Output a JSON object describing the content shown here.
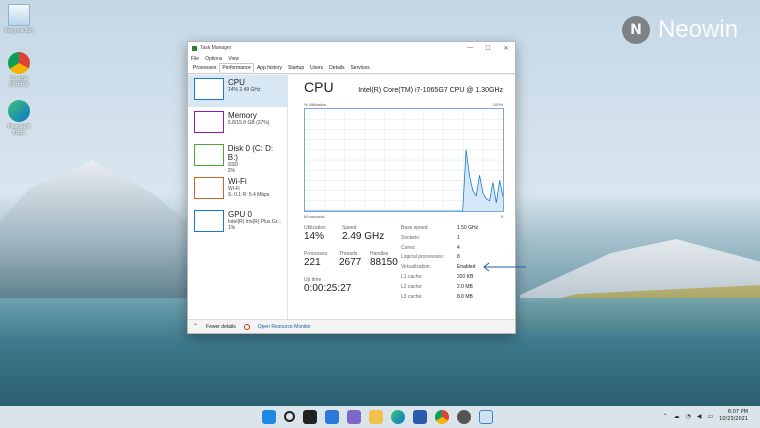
{
  "desktop": {
    "icons": [
      {
        "label": "Recycle Bin",
        "icon": "recycle-bin-icon"
      },
      {
        "label": "Google Chrome",
        "icon": "chrome-icon"
      },
      {
        "label": "Microsoft Edge",
        "icon": "edge-icon"
      }
    ],
    "watermark": "Neowin"
  },
  "window": {
    "title": "Task Manager",
    "menu": [
      "File",
      "Options",
      "View"
    ],
    "tabs": [
      "Processes",
      "Performance",
      "App history",
      "Startup",
      "Users",
      "Details",
      "Services"
    ],
    "active_tab": "Performance"
  },
  "sidebar": {
    "items": [
      {
        "name": "CPU",
        "line1": "14% 2.49 GHz",
        "line2": "",
        "color": "#1a7ac9"
      },
      {
        "name": "Memory",
        "line1": "5.8/15.8 GB (37%)",
        "line2": "",
        "color": "#8c1cc2"
      },
      {
        "name": "Disk 0 (C: D: B:)",
        "line1": "SSD",
        "line2": "2%",
        "color": "#4da835"
      },
      {
        "name": "Wi-Fi",
        "line1": "Wi-Fi",
        "line2": "S: 0.1 R: 5.4 Mbps",
        "color": "#c8672a"
      },
      {
        "name": "GPU 0",
        "line1": "Intel(R) Iris(R) Plus Gr...",
        "line2": "1%",
        "color": "#1a7ac9"
      }
    ]
  },
  "detail": {
    "heading": "CPU",
    "model": "Intel(R) Core(TM) i7-1065G7 CPU @ 1.30GHz",
    "graph_label_left": "% Utilization",
    "graph_label_right": "100%",
    "graph_bottom_left": "60 seconds",
    "graph_bottom_right": "0",
    "utilization_key": "Utilization",
    "utilization_val": "14%",
    "speed_key": "Speed",
    "speed_val": "2.49 GHz",
    "processes_key": "Processes",
    "processes_val": "221",
    "threads_key": "Threads",
    "threads_val": "2677",
    "handles_key": "Handles",
    "handles_val": "88150",
    "uptime_key": "Up time",
    "uptime_val": "0:00:25:27",
    "specs": [
      {
        "k": "Base speed:",
        "v": "1.50 GHz"
      },
      {
        "k": "Sockets:",
        "v": "1"
      },
      {
        "k": "Cores:",
        "v": "4"
      },
      {
        "k": "Logical processors:",
        "v": "8"
      },
      {
        "k": "Virtualization:",
        "v": "Enabled"
      },
      {
        "k": "L1 cache:",
        "v": "320 KB"
      },
      {
        "k": "L2 cache:",
        "v": "2.0 MB"
      },
      {
        "k": "L3 cache:",
        "v": "8.0 MB"
      }
    ]
  },
  "footer": {
    "fewer_details": "Fewer details",
    "open_monitor": "Open Resource Monitor"
  },
  "taskbar": {
    "apps": [
      "start-icon",
      "search-icon",
      "task-view-icon",
      "widgets-icon",
      "teams-chat-icon",
      "file-explorer-icon",
      "edge-icon",
      "store-icon",
      "chrome-icon",
      "chrome-dev-icon",
      "task-manager-icon"
    ],
    "time": "6:07 PM",
    "date": "10/23/2021"
  },
  "graph_series": [
    0,
    0,
    0,
    0,
    0,
    0,
    0,
    0,
    0,
    0,
    0,
    0,
    0,
    0,
    0,
    0,
    0,
    0,
    0,
    0,
    0,
    0,
    0,
    0,
    0,
    0,
    0,
    0,
    0,
    0,
    0,
    0,
    0,
    0,
    0,
    0,
    0,
    0,
    0,
    0,
    0,
    0,
    0,
    0,
    0,
    0,
    0,
    0,
    60,
    35,
    20,
    15,
    35,
    18,
    12,
    10,
    28,
    8,
    30,
    14
  ]
}
